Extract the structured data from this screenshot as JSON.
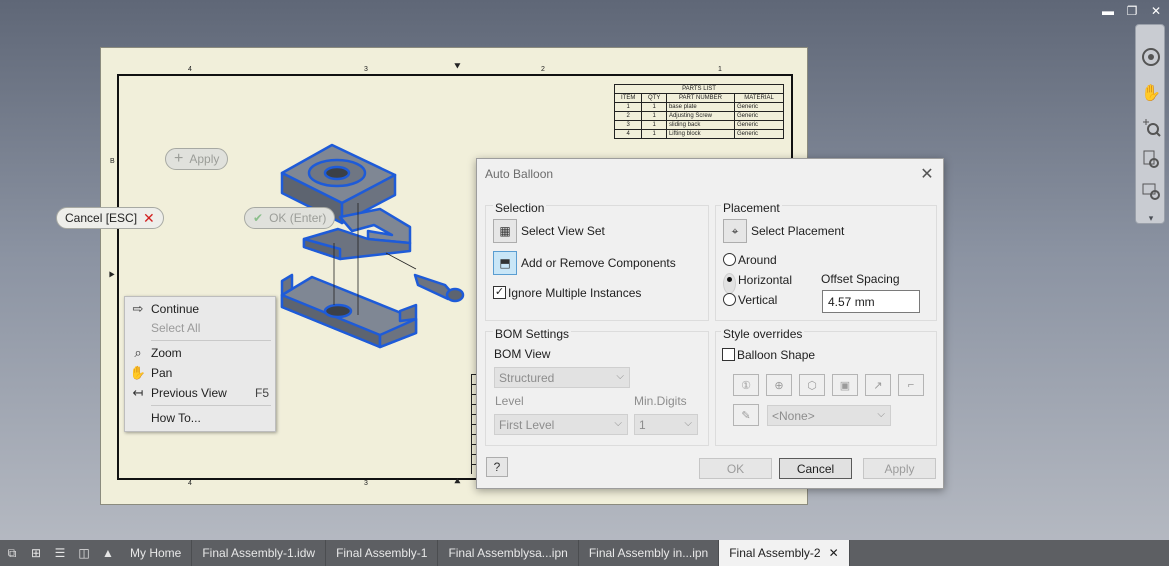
{
  "window_controls": {
    "minimize": "▬",
    "restore": "❐",
    "close": "✕"
  },
  "navbar": {
    "icons": [
      "steering-wheel-icon",
      "pan-hand-icon",
      "zoom-icon",
      "zoom-all-icon",
      "zoom-window-icon"
    ]
  },
  "drawing": {
    "zone_top": [
      "4",
      "3",
      "2",
      "1"
    ],
    "zone_bottom": [
      "4",
      "3"
    ],
    "zone_left": [
      "B"
    ],
    "parts_list": {
      "title": "PARTS LIST",
      "headers": [
        "ITEM",
        "QTY",
        "PART NUMBER",
        "MATERIAL"
      ],
      "rows": [
        [
          "1",
          "1",
          "base plate",
          "Generic"
        ],
        [
          "2",
          "1",
          "Adjusting Screw",
          "Generic"
        ],
        [
          "3",
          "1",
          "sliding back",
          "Generic"
        ],
        [
          "4",
          "1",
          "Lifting block",
          "Generic"
        ]
      ]
    }
  },
  "minitoolbar": {
    "apply": "Apply",
    "cancel": "Cancel [ESC]",
    "ok": "OK (Enter)"
  },
  "context_menu": {
    "items": [
      {
        "label": "Continue",
        "icon": "continue-arrow-icon",
        "shortcut": ""
      },
      {
        "label": "Select All",
        "icon": "",
        "shortcut": ""
      },
      {
        "label": "Zoom",
        "icon": "zoom-icon",
        "shortcut": ""
      },
      {
        "label": "Pan",
        "icon": "pan-hand-icon",
        "shortcut": ""
      },
      {
        "label": "Previous View",
        "icon": "previous-view-icon",
        "shortcut": "F5"
      },
      {
        "label": "How To...",
        "icon": "",
        "shortcut": ""
      }
    ]
  },
  "dialog": {
    "title": "Auto Balloon",
    "selection": {
      "title": "Selection",
      "select_view_set": "Select View Set",
      "add_remove": "Add or Remove Components",
      "ignore_multiple": "Ignore Multiple Instances"
    },
    "placement": {
      "title": "Placement",
      "select_placement": "Select Placement",
      "around": "Around",
      "horizontal": "Horizontal",
      "vertical": "Vertical",
      "offset_label": "Offset Spacing",
      "offset_value": "4.57 mm"
    },
    "bom": {
      "title": "BOM Settings",
      "view_label": "BOM View",
      "view_value": "Structured",
      "level_label": "Level",
      "level_value": "First Level",
      "digits_label": "Min.Digits",
      "digits_value": "1"
    },
    "style": {
      "title": "Style overrides",
      "balloon_shape": "Balloon Shape",
      "none_value": "<None>"
    },
    "buttons": {
      "ok": "OK",
      "cancel": "Cancel",
      "apply": "Apply"
    }
  },
  "taskbar": {
    "tabs": [
      "My Home",
      "Final Assembly-1.idw",
      "Final Assembly-1",
      "Final Assemblysa...ipn",
      "Final Assembly in...ipn",
      "Final Assembly-2"
    ],
    "active_close": "✕"
  },
  "colors": {
    "accent": "#1e5bd8",
    "sheet": "#f1efda",
    "background_top": "#5f6777"
  }
}
